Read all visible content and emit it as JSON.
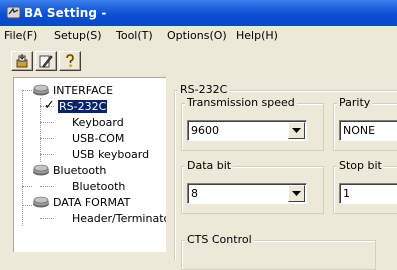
{
  "window": {
    "title": "BA Setting -"
  },
  "menu": [
    {
      "label": "File(F)"
    },
    {
      "label": "Setup(S)"
    },
    {
      "label": "Tool(T)"
    },
    {
      "label": "Options(O)"
    },
    {
      "label": "Help(H)"
    }
  ],
  "tree": {
    "interface": "INTERFACE",
    "rs232c": "RS-232C",
    "keyboard": "Keyboard",
    "usb_com": "USB-COM",
    "usb_keyboard": "USB keyboard",
    "bluetooth_group": "Bluetooth",
    "bluetooth_item": "Bluetooth",
    "data_format": "DATA FORMAT",
    "header_terminator": "Header/Terminatc",
    "checkmark": "✓"
  },
  "panel": {
    "group_title": "RS-232C",
    "transmission_speed": {
      "label": "Transmission speed",
      "value": "9600"
    },
    "parity": {
      "label": "Parity",
      "value": "NONE"
    },
    "data_bit": {
      "label": "Data bit",
      "value": "8"
    },
    "stop_bit": {
      "label": "Stop bit",
      "value": "1"
    },
    "cts_control": {
      "label": "CTS Control"
    }
  },
  "colors": {
    "titlebar": "#0b4fd6",
    "selection": "#0a246a",
    "face": "#ece9d8"
  }
}
